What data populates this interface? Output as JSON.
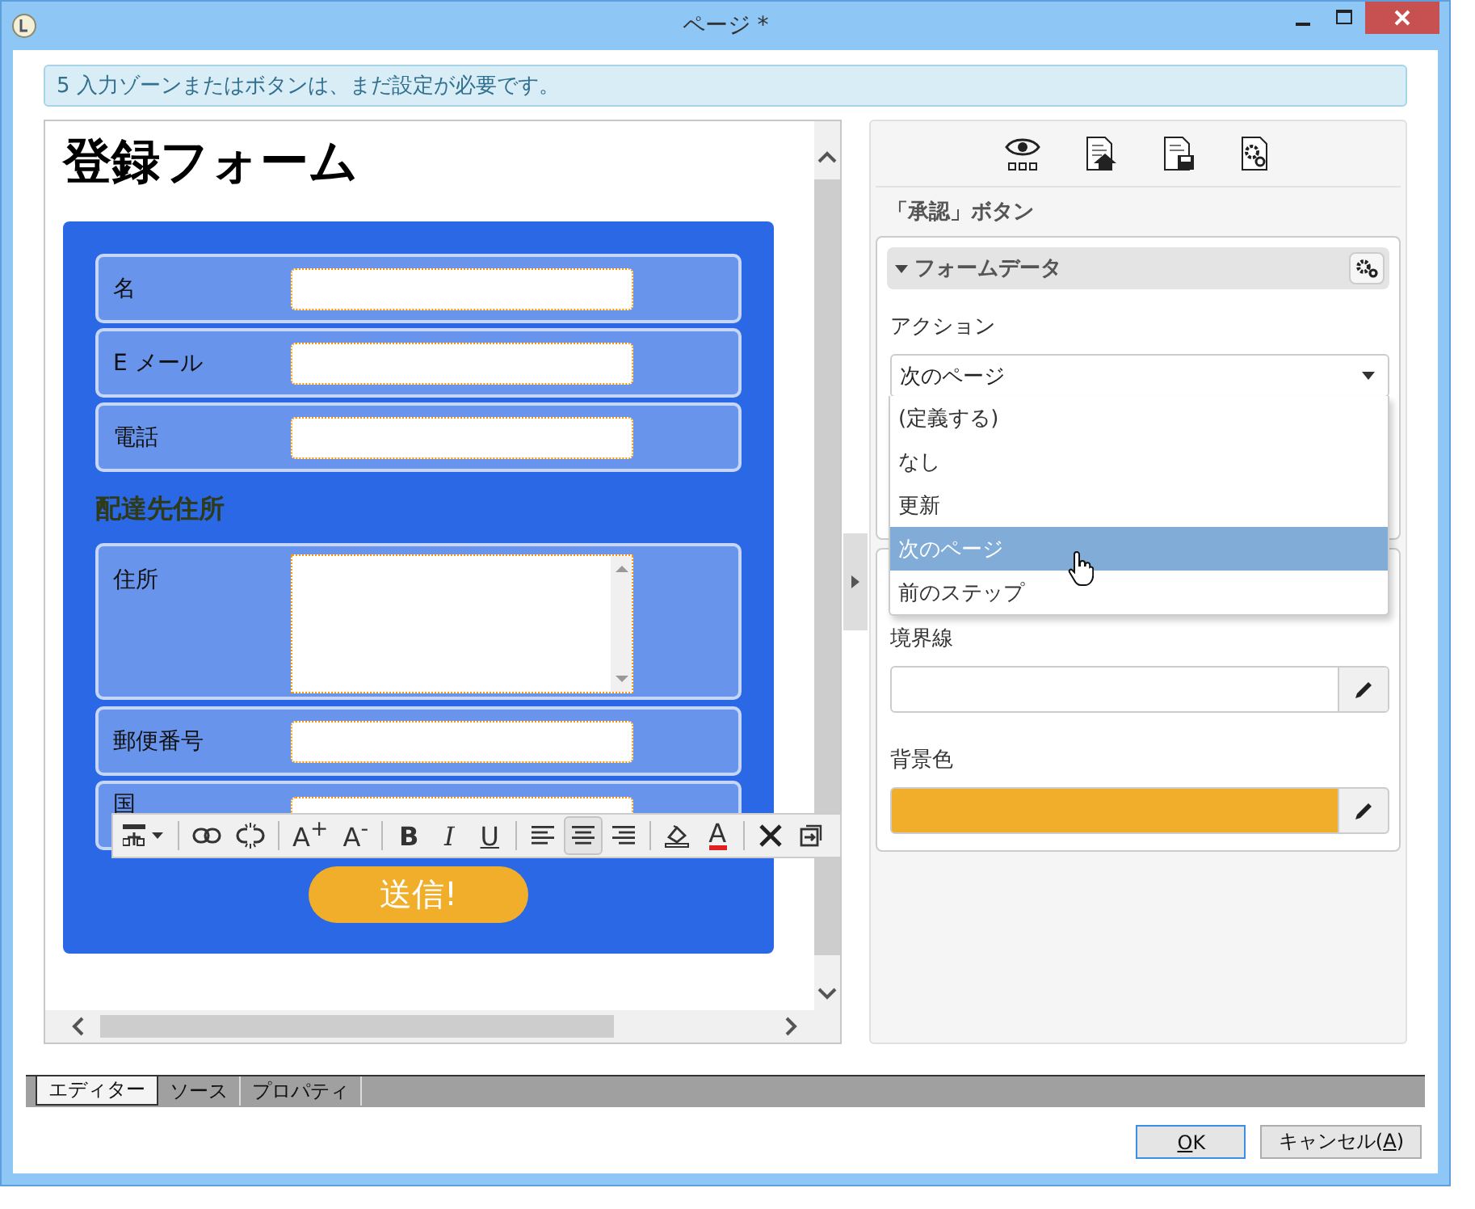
{
  "window": {
    "title": "ページ *"
  },
  "notice": "5 入力ゾーンまたはボタンは、まだ設定が必要です。",
  "form": {
    "title": "登録フォーム",
    "submit": "送信!",
    "fields": [
      {
        "kind": "text",
        "label": "名"
      },
      {
        "kind": "text",
        "label": "E メール"
      },
      {
        "kind": "text",
        "label": "電話"
      },
      {
        "kind": "heading",
        "label": "配達先住所"
      },
      {
        "kind": "textarea",
        "label": "住所"
      },
      {
        "kind": "text",
        "label": "郵便番号"
      },
      {
        "kind": "text",
        "label": "国"
      }
    ]
  },
  "toolbar": [
    [
      {
        "kind": "insert",
        "selected": false
      }
    ],
    [
      {
        "kind": "link",
        "selected": false
      },
      {
        "kind": "unlink",
        "selected": false
      }
    ],
    [
      {
        "kind": "grow",
        "label": "A$^{+}$",
        "selected": false
      },
      {
        "kind": "shrink",
        "label": "A$^{-}$",
        "selected": false
      }
    ],
    [
      {
        "kind": "bold",
        "label": "B",
        "selected": false
      },
      {
        "kind": "italic",
        "label": "I",
        "selected": false
      },
      {
        "kind": "underline",
        "label": "U",
        "selected": false
      }
    ],
    [
      {
        "kind": "align-left",
        "selected": false
      },
      {
        "kind": "align-center",
        "selected": true
      },
      {
        "kind": "align-right",
        "selected": false
      }
    ],
    [
      {
        "kind": "fill",
        "selected": false
      },
      {
        "kind": "color",
        "label": "A",
        "selected": false
      }
    ],
    [
      {
        "kind": "clear",
        "selected": false
      },
      {
        "kind": "paste",
        "selected": false
      }
    ]
  ],
  "properties": {
    "title": "「承認」ボタン",
    "section": {
      "title": "フォームデータ",
      "expanded": true
    },
    "action": {
      "label": "アクション",
      "value": "次のページ",
      "open": true,
      "options": [
        {
          "label": "(定義する)",
          "selected": false
        },
        {
          "label": "なし",
          "selected": false
        },
        {
          "label": "更新",
          "selected": false
        },
        {
          "label": "次のページ",
          "selected": true
        },
        {
          "label": "前のステップ",
          "selected": false
        }
      ]
    },
    "border": {
      "label": "境界線"
    },
    "background": {
      "label": "背景色",
      "color": "#f0ae2a"
    }
  },
  "tabs": [
    {
      "label": "エディター",
      "selected": true
    },
    {
      "label": "ソース",
      "selected": false
    },
    {
      "label": "プロパティ",
      "selected": false
    }
  ],
  "buttons": [
    {
      "key": "O",
      "after": "K",
      "default": true
    },
    {
      "before": "キャンセル(",
      "key": "A",
      "after": ")",
      "default": false
    }
  ]
}
